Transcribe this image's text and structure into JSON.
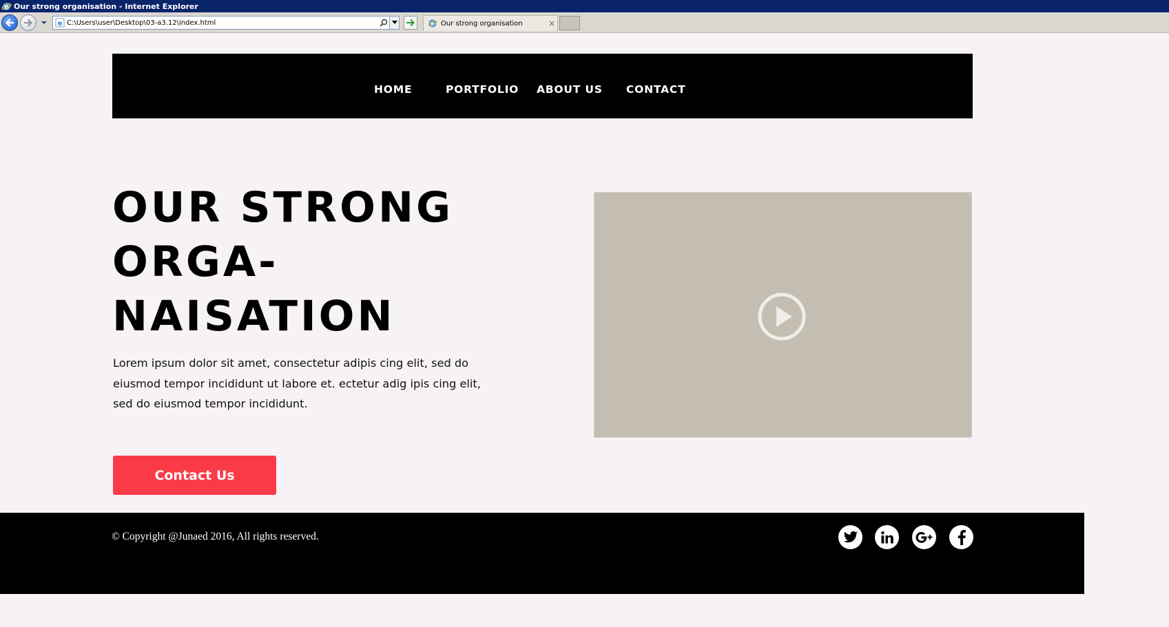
{
  "browser": {
    "window_title": "Our strong organisation - Internet Explorer",
    "address": "C:\\Users\\user\\Desktop\\03-a3.12\\index.html",
    "tab_label": "Our strong organisation",
    "tab_close": "×"
  },
  "nav": {
    "items": [
      {
        "label": "HOME"
      },
      {
        "label": "PORTFOLIO"
      },
      {
        "label": "ABOUT US"
      },
      {
        "label": "CONTACT"
      }
    ]
  },
  "hero": {
    "title_lines": [
      "OUR STRONG",
      "ORGA-",
      "NAISATION"
    ],
    "paragraph": "Lorem ipsum dolor sit amet, consectetur adipis cing elit, sed do eiusmod tempor incididunt ut labore et. ectetur adig ipis cing elit, sed do eiusmod tempor incididunt.",
    "cta_label": "Contact Us"
  },
  "video": {
    "icon": "play-icon"
  },
  "footer": {
    "copyright": "© Copyright @Junaed 2016, All rights reserved.",
    "social": [
      {
        "icon": "twitter-icon",
        "label": "t"
      },
      {
        "icon": "linkedin-icon",
        "label": "in"
      },
      {
        "icon": "google-plus-icon",
        "label": "G+"
      },
      {
        "icon": "facebook-icon",
        "label": "f"
      }
    ]
  },
  "colors": {
    "titlebar": "#0a246a",
    "page_bg": "#f6f2f5",
    "nav_bg": "#000000",
    "cta_bg": "#fb3a47",
    "video_bg": "#c4bdb2",
    "footer_bg": "#000000"
  }
}
